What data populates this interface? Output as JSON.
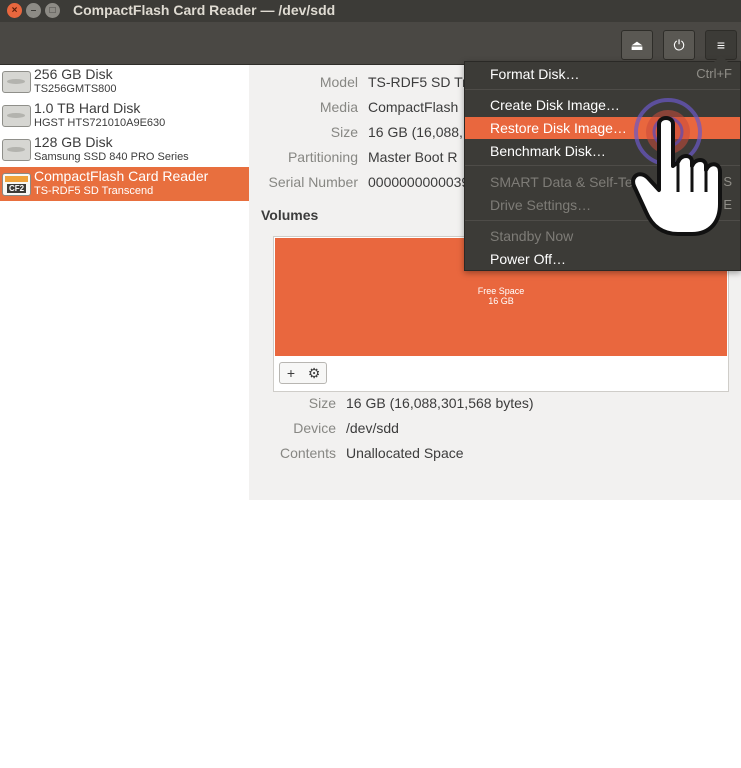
{
  "window": {
    "title": "CompactFlash Card Reader — /dev/sdd",
    "close_glyph": "×",
    "min_glyph": "–",
    "max_glyph": "□"
  },
  "header": {
    "eject_icon": "⏏",
    "power_icon": "⏻",
    "menu_icon": "≡"
  },
  "sidebar": {
    "drives": [
      {
        "name": "256 GB Disk",
        "sub": "TS256GMTS800",
        "icon": "disk-icon"
      },
      {
        "name": "1.0 TB Hard Disk",
        "sub": "HGST HTS721010A9E630",
        "icon": "disk-icon"
      },
      {
        "name": "128 GB Disk",
        "sub": "Samsung SSD 840 PRO Series",
        "icon": "disk-icon"
      },
      {
        "name": "CompactFlash Card Reader",
        "sub": "TS-RDF5 SD  Transcend",
        "icon": "compactflash-icon",
        "icon_label": "CF2",
        "selected": true
      }
    ]
  },
  "details": {
    "model_label": "Model",
    "model_value": "TS-RDF5 SD  Tr",
    "media_label": "Media",
    "media_value": "CompactFlash",
    "size_label": "Size",
    "size_value": "16 GB (16,088,",
    "partitioning_label": "Partitioning",
    "partitioning_value": "Master Boot R",
    "serial_label": "Serial Number",
    "serial_value": "0000000000039"
  },
  "volumes": {
    "heading": "Volumes",
    "free_space_label": "Free Space",
    "free_space_size": "16 GB",
    "add_glyph": "+",
    "gear_glyph": "⚙",
    "size_label": "Size",
    "size_value": "16 GB (16,088,301,568 bytes)",
    "device_label": "Device",
    "device_value": "/dev/sdd",
    "contents_label": "Contents",
    "contents_value": "Unallocated Space"
  },
  "menu": {
    "format": "Format Disk…",
    "format_key": "Ctrl+F",
    "create_image": "Create Disk Image…",
    "restore_image": "Restore Disk Image…",
    "benchmark": "Benchmark Disk…",
    "smart": "SMART Data & Self-Tests…",
    "smart_key": "S",
    "drive_settings": "Drive Settings…",
    "drive_settings_key": "E",
    "standby": "Standby Now",
    "power_off": "Power Off…"
  },
  "colors": {
    "accent": "#e9673e",
    "titlebar": "#3c3b37"
  }
}
